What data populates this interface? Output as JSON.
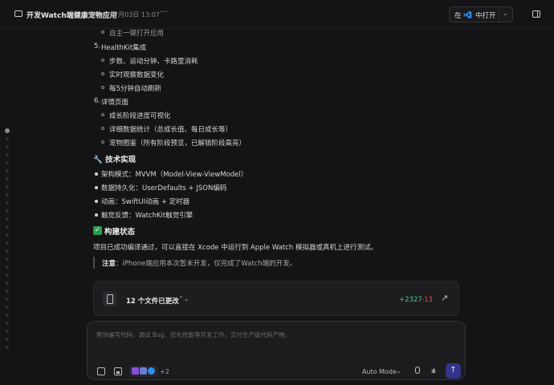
{
  "titlebar": {
    "title": "开发Watch端健康宠物应用",
    "date": "07月03日 13:07",
    "more": "···",
    "open_in_prefix": "在",
    "open_in_label": "中打开",
    "chevron": "⌄"
  },
  "content": {
    "cut_top_line": "自主一键打开应用",
    "section5": {
      "num": "5.",
      "title": "HealthKit集成",
      "items": [
        "步数、运动分钟、卡路里消耗",
        "实时观察数据变化",
        "每5分钟自动刷新"
      ]
    },
    "section6": {
      "num": "6.",
      "title": "详情页面",
      "items": [
        "成长阶段进度可视化",
        "详细数据统计（总成长值、每日成长等）",
        "宠物图鉴（所有阶段预览，已解锁阶段高亮）"
      ]
    },
    "tech_heading": "🔧 技术实现",
    "tech_items": [
      "架构模式：MVVM（Model-View-ViewModel）",
      "数据持久化：UserDefaults + JSON编码",
      "动画：SwiftUI动画 + 定时器",
      "触觉反馈：WatchKit触觉引擎"
    ],
    "build_heading": "构建状态",
    "build_check": "✓",
    "build_text": "项目已成功编译通过，可以直接在 Xcode 中运行到 Apple Watch 模拟器或真机上进行测试。",
    "note_label": "注意",
    "note_text": "：iPhone端应用本次暂未开发，仅完成了Watch端的开发。"
  },
  "files_card": {
    "label": "12 个文件已更改",
    "chevron": "⌃⌄",
    "additions": "+2327",
    "deletions": "-13",
    "expand": "↗"
  },
  "composer": {
    "placeholder": "帮你编写代码、调试 Bug、优化性能等开发工作，交付生产级代码产物。",
    "extra_count": "+2",
    "mode_label": "Auto Mode",
    "mode_chevron": "⌄",
    "send": "↑",
    "wave": "ıılı"
  },
  "colors": {
    "background": "#141416",
    "additions": "#4cc38a",
    "deletions": "#e5484d",
    "send_button": "#34348a",
    "check": "#2e9b4a",
    "vscode_blue": "#2f8ef0"
  }
}
